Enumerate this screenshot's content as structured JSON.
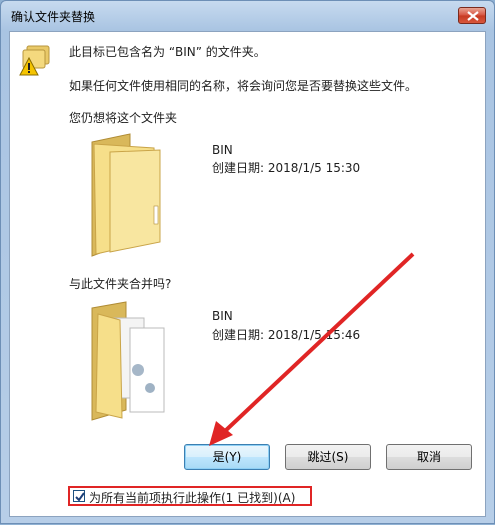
{
  "window": {
    "title": "确认文件夹替换"
  },
  "message": {
    "line1": "此目标已包含名为 “BIN” 的文件夹。",
    "line2": "如果任何文件使用相同的名称，将会询问您是否要替换这些文件。",
    "question1": "您仍想将这个文件夹",
    "question2": "与此文件夹合并吗?"
  },
  "existing_folder": {
    "name": "BIN",
    "created": "创建日期: 2018/1/5 15:30"
  },
  "new_folder": {
    "name": "BIN",
    "created": "创建日期: 2018/1/5 15:46"
  },
  "buttons": {
    "yes": "是(Y)",
    "skip": "跳过(S)",
    "cancel": "取消"
  },
  "checkbox": {
    "label": "为所有当前项执行此操作(1 已找到)(A)",
    "checked": true
  },
  "colors": {
    "annotation_red": "#e02525",
    "folder_yellow": "#f3d77a"
  }
}
